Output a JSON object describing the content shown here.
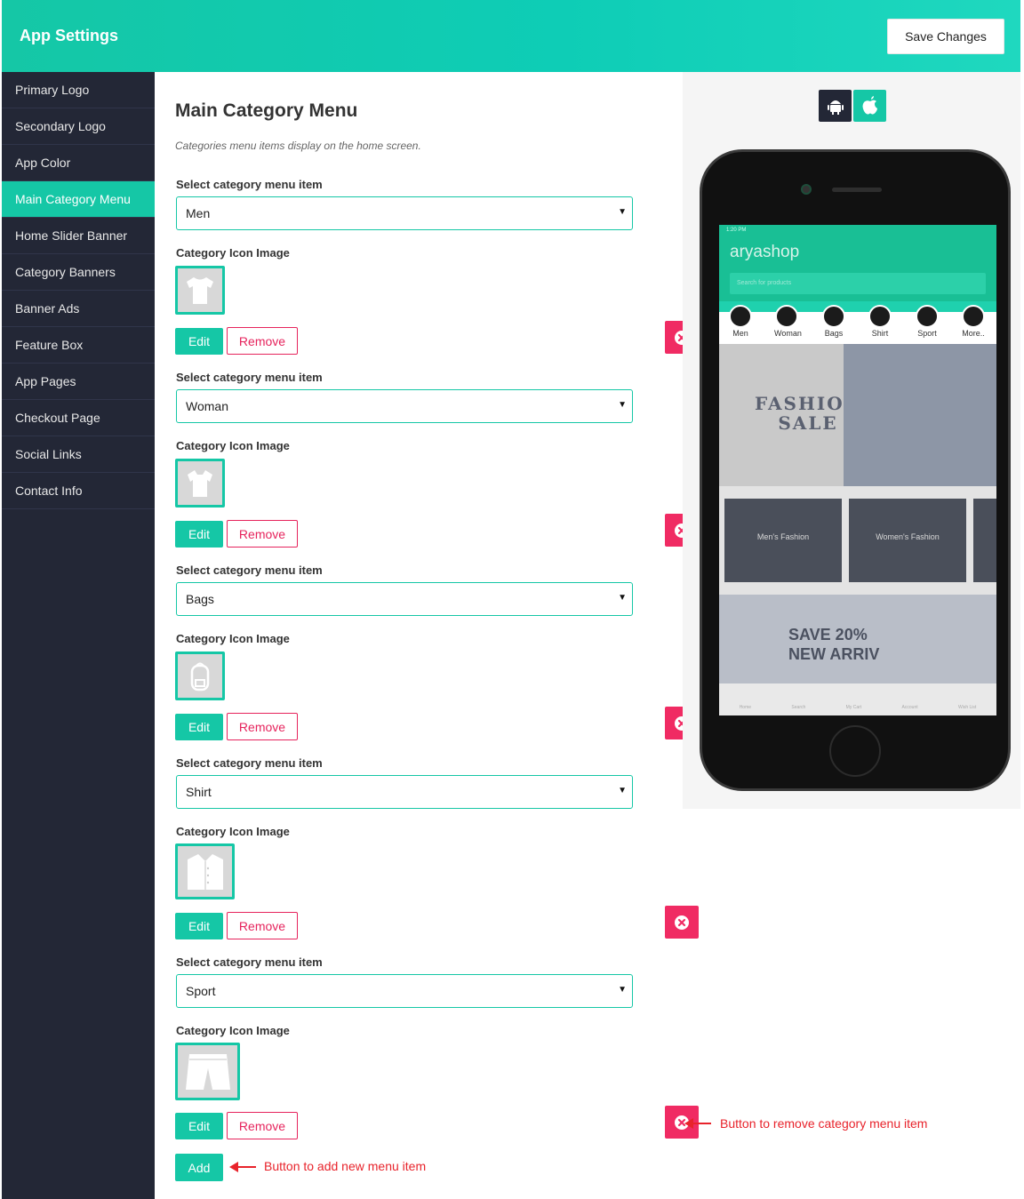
{
  "header": {
    "title": "App Settings",
    "save_label": "Save Changes"
  },
  "sidebar": {
    "items": [
      {
        "label": "Primary Logo"
      },
      {
        "label": "Secondary Logo"
      },
      {
        "label": "App Color"
      },
      {
        "label": "Main Category Menu",
        "active": true
      },
      {
        "label": "Home Slider Banner"
      },
      {
        "label": "Category Banners"
      },
      {
        "label": "Banner Ads"
      },
      {
        "label": "Feature Box"
      },
      {
        "label": "App Pages"
      },
      {
        "label": "Checkout Page"
      },
      {
        "label": "Social Links"
      },
      {
        "label": "Contact Info"
      }
    ]
  },
  "main": {
    "title": "Main Category Menu",
    "description": "Categories menu items display on the home screen.",
    "select_label": "Select category menu item",
    "image_label": "Category Icon Image",
    "edit_label": "Edit",
    "remove_label": "Remove",
    "add_label": "Add",
    "items": [
      {
        "value": "Men",
        "icon": "tshirt-icon"
      },
      {
        "value": "Woman",
        "icon": "blouse-icon"
      },
      {
        "value": "Bags",
        "icon": "backpack-icon"
      },
      {
        "value": "Shirt",
        "icon": "shirt-icon"
      },
      {
        "value": "Sport",
        "icon": "shorts-icon"
      }
    ]
  },
  "annotations": {
    "remove_note": "Button to remove category menu item",
    "add_note": "Button to add new menu item"
  },
  "preview": {
    "brand": "aryashop",
    "status_time": "1:20 PM",
    "search_placeholder": "Search for products",
    "categories": [
      "Men",
      "Woman",
      "Bags",
      "Shirt",
      "Sport",
      "More.."
    ],
    "banner_text": "FASHION SALE",
    "tile1": "Men's Fashion",
    "tile2": "Women's Fashion",
    "banner2_text": "SAVE 20% NEW ARRIV",
    "tabs": [
      "Home",
      "Search",
      "My Cart",
      "Account",
      "Wish List"
    ]
  },
  "colors": {
    "accent": "#15c7a6",
    "danger": "#f02b63",
    "sidebar": "#232736",
    "annotation": "#e8232b"
  }
}
